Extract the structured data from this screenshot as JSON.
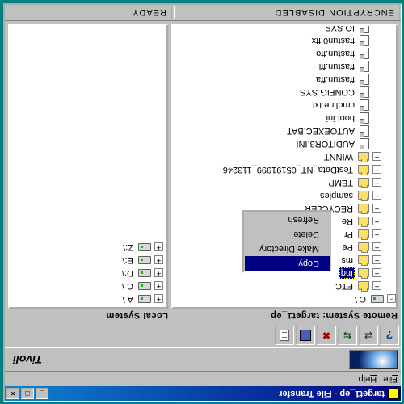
{
  "title": "target1_ep - File Transfer",
  "menubar": {
    "file": "File",
    "help": "Help"
  },
  "brand": "Tivoli",
  "toolbar_icons": [
    "help-icon",
    "transfer-right-icon",
    "transfer-left-icon",
    "delete-icon",
    "save-icon",
    "list-icon"
  ],
  "panels": {
    "remote_title": "Remote System: target1_ep",
    "local_title": "Local System"
  },
  "remote_root": "C:\\",
  "remote_folders": [
    "ETC",
    "Inq",
    "ms",
    "Pe",
    "Pr",
    "Re",
    "RECYCLER",
    "samples",
    "TEMP",
    "TestData_NT_05191999_113246",
    "WINNT"
  ],
  "remote_selected_index": 1,
  "remote_trailing_label": "ms",
  "remote_files": [
    "AUDITOR3.INI",
    "AUTOEXEC.BAT",
    "boot.ini",
    "cmdline.txt",
    "CONFIG.SYS",
    "ffastun.ffa",
    "ffastun.ffl",
    "ffastun.ffo",
    "ffastun0.ffx",
    "IO.SYS"
  ],
  "local_drives": [
    "A:\\",
    "C:\\",
    "D:\\",
    "E:\\",
    "Z:\\"
  ],
  "context_menu": {
    "items": [
      "Copy",
      "Make Directory",
      "Delete",
      "Refresh"
    ]
  },
  "status": {
    "left": "ENCRYPTION DISABLED",
    "right": "READY"
  },
  "win_buttons": {
    "min": "_",
    "max": "□",
    "close": "×"
  }
}
